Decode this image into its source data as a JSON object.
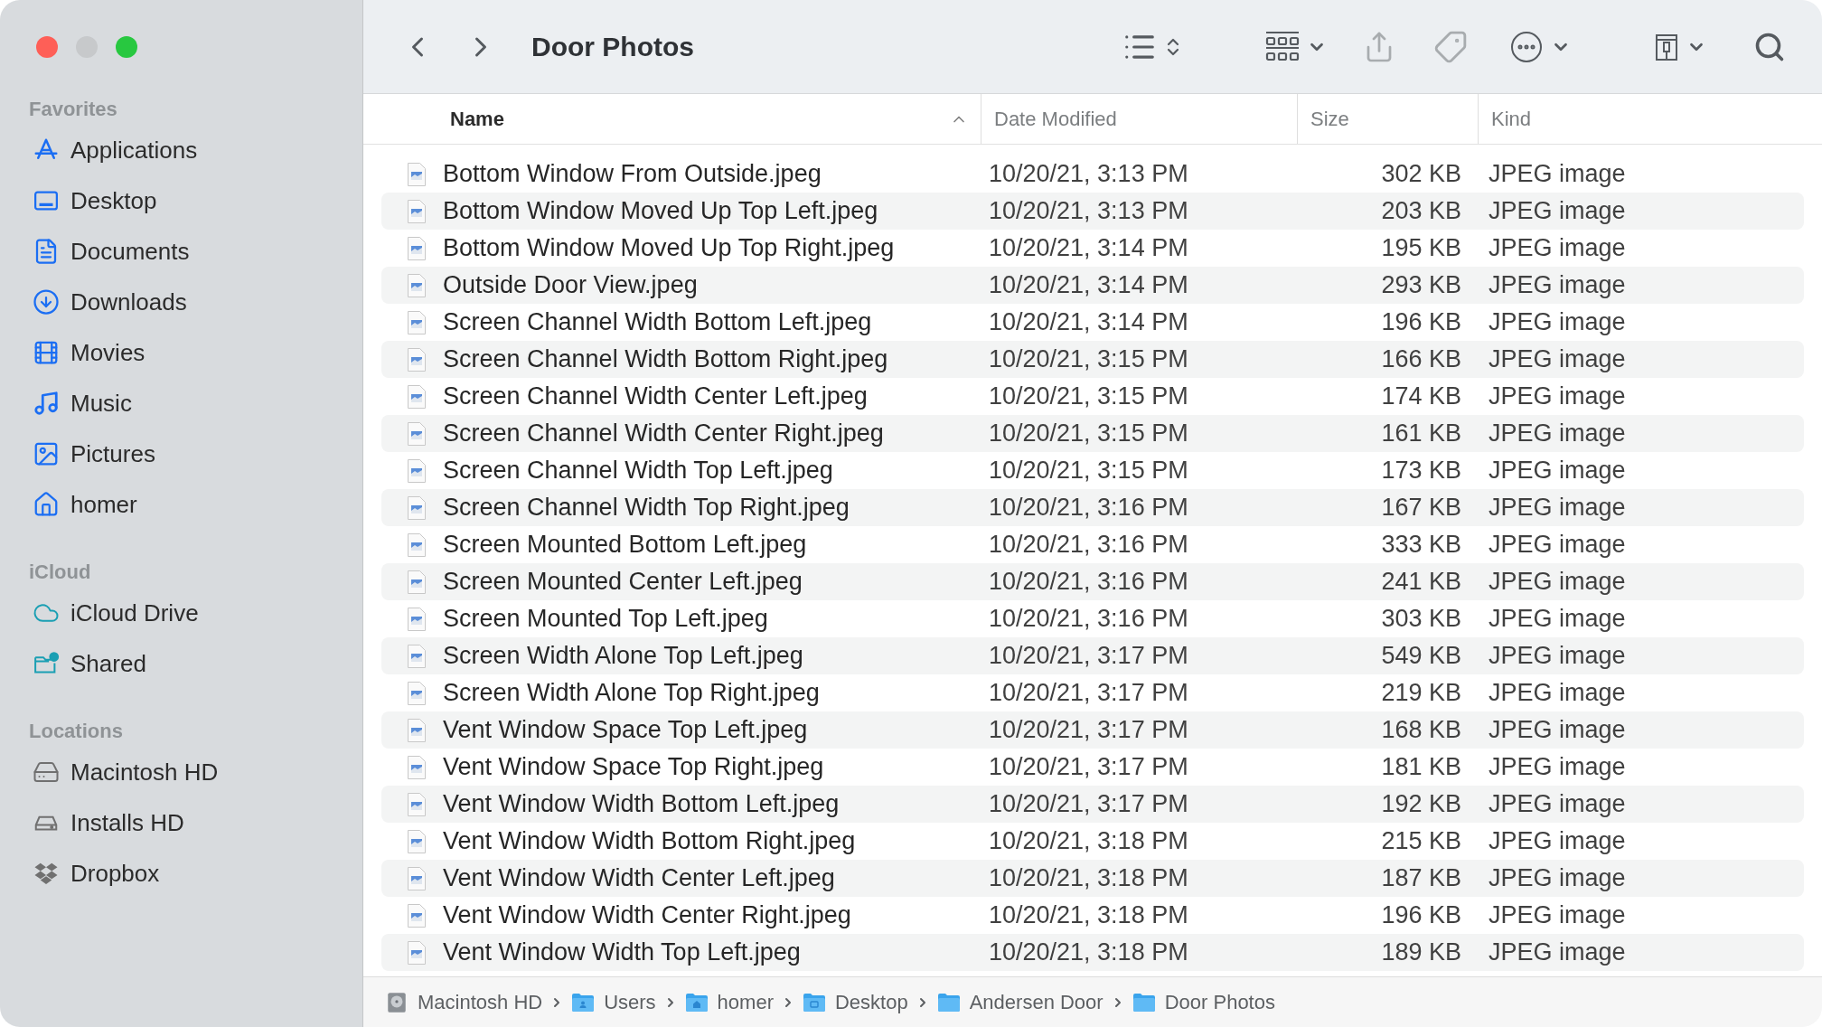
{
  "window": {
    "title": "Door Photos",
    "controls": [
      {
        "kind": "close",
        "enabled": true
      },
      {
        "kind": "minimize",
        "enabled": false
      },
      {
        "kind": "zoom",
        "enabled": true
      }
    ]
  },
  "sidebar": {
    "sections": [
      {
        "title": "Favorites",
        "items": [
          {
            "label": "Applications",
            "kind": "applications"
          },
          {
            "label": "Desktop",
            "kind": "desktop"
          },
          {
            "label": "Documents",
            "kind": "documents"
          },
          {
            "label": "Downloads",
            "kind": "downloads"
          },
          {
            "label": "Movies",
            "kind": "movies"
          },
          {
            "label": "Music",
            "kind": "music"
          },
          {
            "label": "Pictures",
            "kind": "pictures"
          },
          {
            "label": "homer",
            "kind": "home"
          }
        ]
      },
      {
        "title": "iCloud",
        "items": [
          {
            "label": "iCloud Drive",
            "kind": "icloud"
          },
          {
            "label": "Shared",
            "kind": "shared"
          }
        ]
      },
      {
        "title": "Locations",
        "items": [
          {
            "label": "Macintosh HD",
            "kind": "disk"
          },
          {
            "label": "Installs HD",
            "kind": "external"
          },
          {
            "label": "Dropbox",
            "kind": "dropbox"
          }
        ]
      }
    ]
  },
  "table": {
    "columns": [
      {
        "label": "Name",
        "sorted": true
      },
      {
        "label": "Date Modified",
        "sorted": false
      },
      {
        "label": "Size",
        "sorted": false
      },
      {
        "label": "Kind",
        "sorted": false
      }
    ],
    "rows": [
      {
        "name": "Bottom Window From Outside.jpeg",
        "date": "10/20/21, 3:13 PM",
        "size": "302 KB",
        "kind": "JPEG image"
      },
      {
        "name": "Bottom Window Moved Up Top Left.jpeg",
        "date": "10/20/21, 3:13 PM",
        "size": "203 KB",
        "kind": "JPEG image"
      },
      {
        "name": "Bottom Window Moved Up Top Right.jpeg",
        "date": "10/20/21, 3:14 PM",
        "size": "195 KB",
        "kind": "JPEG image"
      },
      {
        "name": "Outside Door View.jpeg",
        "date": "10/20/21, 3:14 PM",
        "size": "293 KB",
        "kind": "JPEG image"
      },
      {
        "name": "Screen Channel Width Bottom Left.jpeg",
        "date": "10/20/21, 3:14 PM",
        "size": "196 KB",
        "kind": "JPEG image"
      },
      {
        "name": "Screen Channel Width Bottom Right.jpeg",
        "date": "10/20/21, 3:15 PM",
        "size": "166 KB",
        "kind": "JPEG image"
      },
      {
        "name": "Screen Channel Width Center Left.jpeg",
        "date": "10/20/21, 3:15 PM",
        "size": "174 KB",
        "kind": "JPEG image"
      },
      {
        "name": "Screen Channel Width Center Right.jpeg",
        "date": "10/20/21, 3:15 PM",
        "size": "161 KB",
        "kind": "JPEG image"
      },
      {
        "name": "Screen Channel Width Top Left.jpeg",
        "date": "10/20/21, 3:15 PM",
        "size": "173 KB",
        "kind": "JPEG image"
      },
      {
        "name": "Screen Channel Width Top Right.jpeg",
        "date": "10/20/21, 3:16 PM",
        "size": "167 KB",
        "kind": "JPEG image"
      },
      {
        "name": "Screen Mounted Bottom Left.jpeg",
        "date": "10/20/21, 3:16 PM",
        "size": "333 KB",
        "kind": "JPEG image"
      },
      {
        "name": "Screen Mounted Center Left.jpeg",
        "date": "10/20/21, 3:16 PM",
        "size": "241 KB",
        "kind": "JPEG image"
      },
      {
        "name": "Screen Mounted Top Left.jpeg",
        "date": "10/20/21, 3:16 PM",
        "size": "303 KB",
        "kind": "JPEG image"
      },
      {
        "name": "Screen Width Alone Top Left.jpeg",
        "date": "10/20/21, 3:17 PM",
        "size": "549 KB",
        "kind": "JPEG image"
      },
      {
        "name": "Screen Width Alone Top Right.jpeg",
        "date": "10/20/21, 3:17 PM",
        "size": "219 KB",
        "kind": "JPEG image"
      },
      {
        "name": "Vent Window Space Top Left.jpeg",
        "date": "10/20/21, 3:17 PM",
        "size": "168 KB",
        "kind": "JPEG image"
      },
      {
        "name": "Vent Window Space Top Right.jpeg",
        "date": "10/20/21, 3:17 PM",
        "size": "181 KB",
        "kind": "JPEG image"
      },
      {
        "name": "Vent Window Width Bottom Left.jpeg",
        "date": "10/20/21, 3:17 PM",
        "size": "192 KB",
        "kind": "JPEG image"
      },
      {
        "name": "Vent Window Width Bottom Right.jpeg",
        "date": "10/20/21, 3:18 PM",
        "size": "215 KB",
        "kind": "JPEG image"
      },
      {
        "name": "Vent Window Width Center Left.jpeg",
        "date": "10/20/21, 3:18 PM",
        "size": "187 KB",
        "kind": "JPEG image"
      },
      {
        "name": "Vent Window Width Center Right.jpeg",
        "date": "10/20/21, 3:18 PM",
        "size": "196 KB",
        "kind": "JPEG image"
      },
      {
        "name": "Vent Window Width Top Left.jpeg",
        "date": "10/20/21, 3:18 PM",
        "size": "189 KB",
        "kind": "JPEG image"
      }
    ]
  },
  "path_bar": [
    {
      "label": "Macintosh HD",
      "kind": "disk"
    },
    {
      "label": "Users",
      "kind": "users"
    },
    {
      "label": "homer",
      "kind": "home"
    },
    {
      "label": "Desktop",
      "kind": "desktop"
    },
    {
      "label": "Andersen Door",
      "kind": "folder"
    },
    {
      "label": "Door Photos",
      "kind": "folder"
    }
  ]
}
